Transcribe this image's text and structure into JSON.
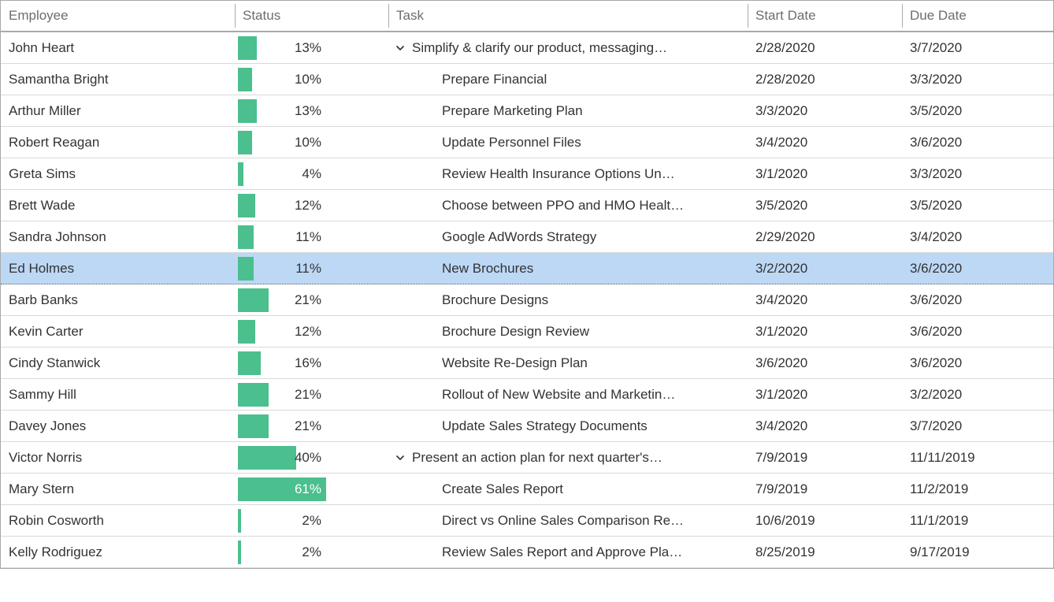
{
  "columns": {
    "employee": "Employee",
    "status": "Status",
    "task": "Task",
    "start": "Start Date",
    "due": "Due Date"
  },
  "colors": {
    "bar": "#4bbf8d",
    "selected": "#bcd8f5"
  },
  "rows": [
    {
      "employee": "John Heart",
      "status": 13,
      "status_text": "13%",
      "task": "Simplify & clarify our product, messaging…",
      "indent": 0,
      "expander": true,
      "start": "2/28/2020",
      "due": "3/7/2020",
      "selected": false
    },
    {
      "employee": "Samantha Bright",
      "status": 10,
      "status_text": "10%",
      "task": "Prepare Financial",
      "indent": 1,
      "expander": false,
      "start": "2/28/2020",
      "due": "3/3/2020",
      "selected": false
    },
    {
      "employee": "Arthur Miller",
      "status": 13,
      "status_text": "13%",
      "task": "Prepare Marketing Plan",
      "indent": 1,
      "expander": false,
      "start": "3/3/2020",
      "due": "3/5/2020",
      "selected": false
    },
    {
      "employee": "Robert Reagan",
      "status": 10,
      "status_text": "10%",
      "task": "Update Personnel Files",
      "indent": 1,
      "expander": false,
      "start": "3/4/2020",
      "due": "3/6/2020",
      "selected": false
    },
    {
      "employee": "Greta Sims",
      "status": 4,
      "status_text": "4%",
      "task": "Review Health Insurance Options Un…",
      "indent": 1,
      "expander": false,
      "start": "3/1/2020",
      "due": "3/3/2020",
      "selected": false
    },
    {
      "employee": "Brett Wade",
      "status": 12,
      "status_text": "12%",
      "task": "Choose between PPO and HMO Healt…",
      "indent": 1,
      "expander": false,
      "start": "3/5/2020",
      "due": "3/5/2020",
      "selected": false
    },
    {
      "employee": "Sandra Johnson",
      "status": 11,
      "status_text": "11%",
      "task": "Google AdWords Strategy",
      "indent": 1,
      "expander": false,
      "start": "2/29/2020",
      "due": "3/4/2020",
      "selected": false
    },
    {
      "employee": "Ed Holmes",
      "status": 11,
      "status_text": "11%",
      "task": "New Brochures",
      "indent": 1,
      "expander": false,
      "start": "3/2/2020",
      "due": "3/6/2020",
      "selected": true
    },
    {
      "employee": "Barb Banks",
      "status": 21,
      "status_text": "21%",
      "task": "Brochure Designs",
      "indent": 1,
      "expander": false,
      "start": "3/4/2020",
      "due": "3/6/2020",
      "selected": false
    },
    {
      "employee": "Kevin Carter",
      "status": 12,
      "status_text": "12%",
      "task": "Brochure Design Review",
      "indent": 1,
      "expander": false,
      "start": "3/1/2020",
      "due": "3/6/2020",
      "selected": false
    },
    {
      "employee": "Cindy Stanwick",
      "status": 16,
      "status_text": "16%",
      "task": "Website Re-Design Plan",
      "indent": 1,
      "expander": false,
      "start": "3/6/2020",
      "due": "3/6/2020",
      "selected": false
    },
    {
      "employee": "Sammy Hill",
      "status": 21,
      "status_text": "21%",
      "task": "Rollout of New Website and Marketin…",
      "indent": 1,
      "expander": false,
      "start": "3/1/2020",
      "due": "3/2/2020",
      "selected": false
    },
    {
      "employee": "Davey Jones",
      "status": 21,
      "status_text": "21%",
      "task": "Update Sales Strategy Documents",
      "indent": 1,
      "expander": false,
      "start": "3/4/2020",
      "due": "3/7/2020",
      "selected": false
    },
    {
      "employee": "Victor Norris",
      "status": 40,
      "status_text": "40%",
      "task": "Present an action plan for next quarter's…",
      "indent": 0,
      "expander": true,
      "start": "7/9/2019",
      "due": "11/11/2019",
      "selected": false
    },
    {
      "employee": "Mary Stern",
      "status": 61,
      "status_text": "61%",
      "task": "Create Sales Report",
      "indent": 1,
      "expander": false,
      "start": "7/9/2019",
      "due": "11/2/2019",
      "selected": false
    },
    {
      "employee": "Robin Cosworth",
      "status": 2,
      "status_text": "2%",
      "task": "Direct vs Online Sales Comparison Re…",
      "indent": 1,
      "expander": false,
      "start": "10/6/2019",
      "due": "11/1/2019",
      "selected": false
    },
    {
      "employee": "Kelly Rodriguez",
      "status": 2,
      "status_text": "2%",
      "task": "Review Sales Report and Approve Pla…",
      "indent": 1,
      "expander": false,
      "start": "8/25/2019",
      "due": "9/17/2019",
      "selected": false
    }
  ]
}
